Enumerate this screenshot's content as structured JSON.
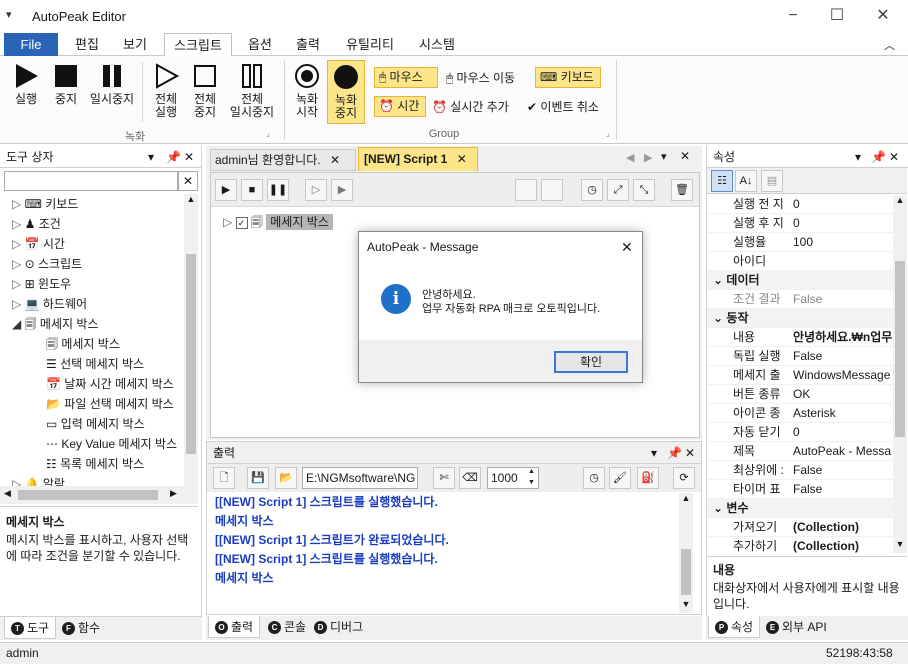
{
  "window": {
    "title": "AutoPeak Editor",
    "app_icon": "▾"
  },
  "menu": {
    "file": "File",
    "items": [
      "편집",
      "보기",
      "스크립트",
      "옵션",
      "출력",
      "유틸리티",
      "시스템"
    ],
    "active_index": 2
  },
  "ribbon": {
    "record_group": {
      "label": "녹화",
      "run": "실행",
      "stop": "중지",
      "pause": "일시중지",
      "run_all_1": "전체",
      "run_all_2": "실행",
      "stop_all_1": "전체",
      "stop_all_2": "중지",
      "pause_all_1": "전체",
      "pause_all_2": "일시중지"
    },
    "group2": {
      "label": "Group",
      "rec_start_1": "녹화",
      "rec_start_2": "시작",
      "rec_stop_1": "녹화",
      "rec_stop_2": "중지",
      "mouse": "마우스",
      "mouse_move": "마우스 이동",
      "keyboard": "키보드",
      "time": "시간",
      "realtime_add": "실시간 추가",
      "event_cancel": "이벤트 취소"
    }
  },
  "toolbox": {
    "title": "도구 상자",
    "search_placeholder": "",
    "items": [
      {
        "label": "키보드",
        "icon": "keyboard-icon"
      },
      {
        "label": "조건",
        "icon": "condition-icon"
      },
      {
        "label": "시간",
        "icon": "calendar-icon"
      },
      {
        "label": "스크립트",
        "icon": "script-icon"
      },
      {
        "label": "윈도우",
        "icon": "windows-icon"
      },
      {
        "label": "하드웨어",
        "icon": "computer-icon"
      },
      {
        "label": "메세지 박스",
        "icon": "messagebox-icon"
      }
    ],
    "children": [
      {
        "label": "메세지 박스"
      },
      {
        "label": "선택 메세지 박스"
      },
      {
        "label": "날짜 시간 메세지 박스"
      },
      {
        "label": "파일 선택 메세지 박스"
      },
      {
        "label": "입력 메세지 박스"
      },
      {
        "label": "Key Value 메세지 박스"
      },
      {
        "label": "목록 메세지 박스"
      }
    ],
    "last_item": "알람",
    "desc_title": "메세지 박스",
    "desc_text": "메시지 박스를 표시하고, 사용자 선택에 따라 조건을 분기할 수 있습니다.",
    "tabs": [
      "도구",
      "함수"
    ]
  },
  "editor": {
    "tabs": [
      "admin님 환영합니다.",
      "[NEW] Script 1"
    ],
    "node_label": "메세지 박스"
  },
  "dialog": {
    "title": "AutoPeak - Message",
    "line1": "안녕하세요.",
    "line2": "업무 자동화 RPA 매크로 오토픽입니다.",
    "ok": "확인"
  },
  "output": {
    "title": "출력",
    "path": "E:\\NGMsoftware\\NG",
    "count": "1000",
    "lines": [
      "[[NEW] Script 1] 스크립트를 실행했습니다.",
      "메세지 박스",
      "[[NEW] Script 1] 스크립트가 완료되었습니다.",
      "[[NEW] Script 1] 스크립트를 실행했습니다.",
      "메세지 박스"
    ],
    "tabs": [
      "출력",
      "콘솔",
      "디버그"
    ]
  },
  "properties": {
    "title": "속성",
    "rows_top": [
      {
        "name": "실행 전 지",
        "value": "0"
      },
      {
        "name": "실행 후 지",
        "value": "0"
      },
      {
        "name": "실행율",
        "value": "100"
      },
      {
        "name": "아이디",
        "value": ""
      }
    ],
    "cat_data": "데이터",
    "rows_data": [
      {
        "name": "조건 결과",
        "value": "False"
      }
    ],
    "cat_action": "동작",
    "rows_action": [
      {
        "name": "내용",
        "value": "안녕하세요.₩n업무"
      },
      {
        "name": "독립 실행",
        "value": "False"
      },
      {
        "name": "메세지 출",
        "value": "WindowsMessage"
      },
      {
        "name": "버튼 종류",
        "value": "OK"
      },
      {
        "name": "아이콘 종",
        "value": "Asterisk"
      },
      {
        "name": "자동 닫기",
        "value": "0"
      },
      {
        "name": "제목",
        "value": "AutoPeak - Messa"
      },
      {
        "name": "최상위에 :",
        "value": "False"
      },
      {
        "name": "타이머 표",
        "value": "False"
      }
    ],
    "cat_var": "변수",
    "rows_var": [
      {
        "name": "가져오기",
        "value": "(Collection)"
      },
      {
        "name": "추가하기",
        "value": "(Collection)"
      }
    ],
    "desc_title": "내용",
    "desc_text": "대화상자에서 사용자에게 표시할 내용입니다.",
    "tabs": [
      "속성",
      "외부 API"
    ]
  },
  "status": {
    "user": "admin",
    "time": "52198:43:58"
  },
  "colors": {
    "accent": "#2b63b7",
    "highlight": "#fde58a",
    "output_text": "#1a3dbf",
    "info": "#1e70c8"
  }
}
